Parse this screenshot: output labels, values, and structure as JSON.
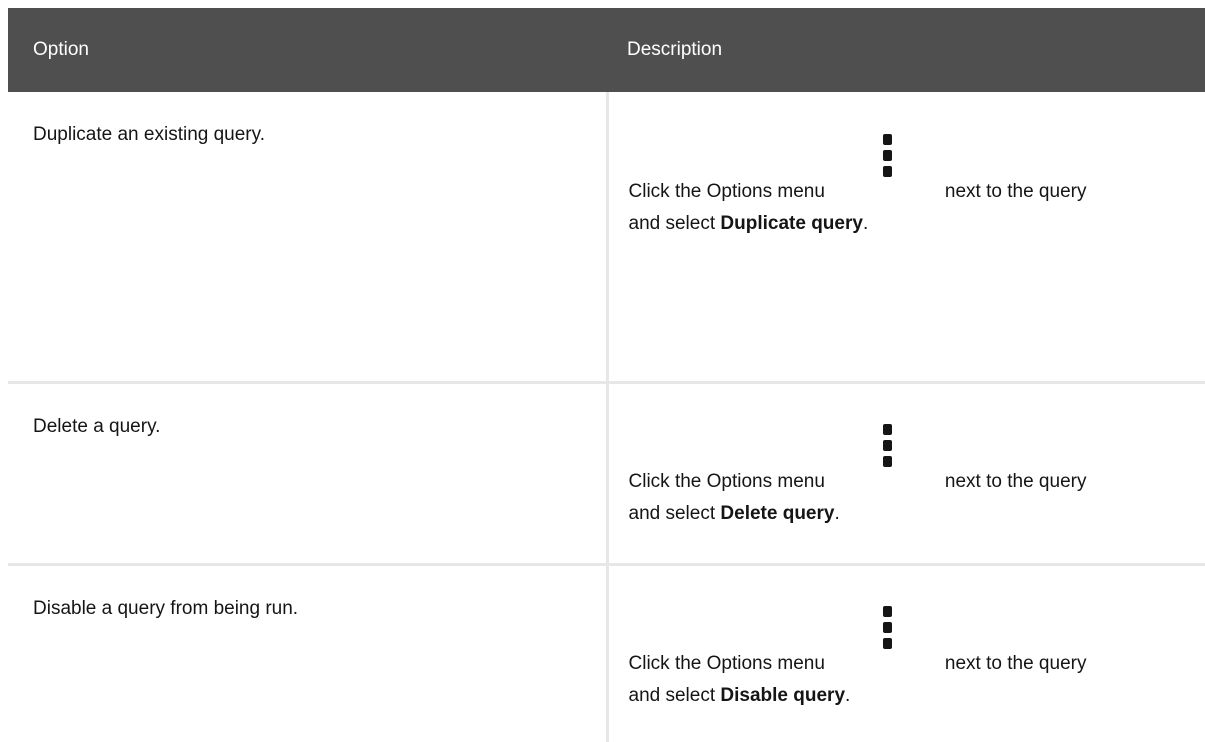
{
  "table": {
    "headers": [
      "Option",
      "Description"
    ],
    "rows": [
      {
        "option": "Duplicate an existing query.",
        "desc_prefix": "Click the Options menu",
        "icon": "kebab-menu-icon",
        "desc_suffix": "next to the query",
        "desc_line2_prefix": "and select ",
        "action": "Duplicate query",
        "desc_end": "."
      },
      {
        "option": "Delete a query.",
        "desc_prefix": "Click the Options menu",
        "icon": "kebab-menu-icon",
        "desc_suffix": "next to the query",
        "desc_line2_prefix": "and select ",
        "action": "Delete query",
        "desc_end": "."
      },
      {
        "option": "Disable a query from being run.",
        "desc_prefix": "Click the Options menu",
        "icon": "kebab-menu-icon",
        "desc_suffix": "next to the query",
        "desc_line2_prefix": "and select ",
        "action": "Disable query",
        "desc_end": "."
      }
    ]
  }
}
